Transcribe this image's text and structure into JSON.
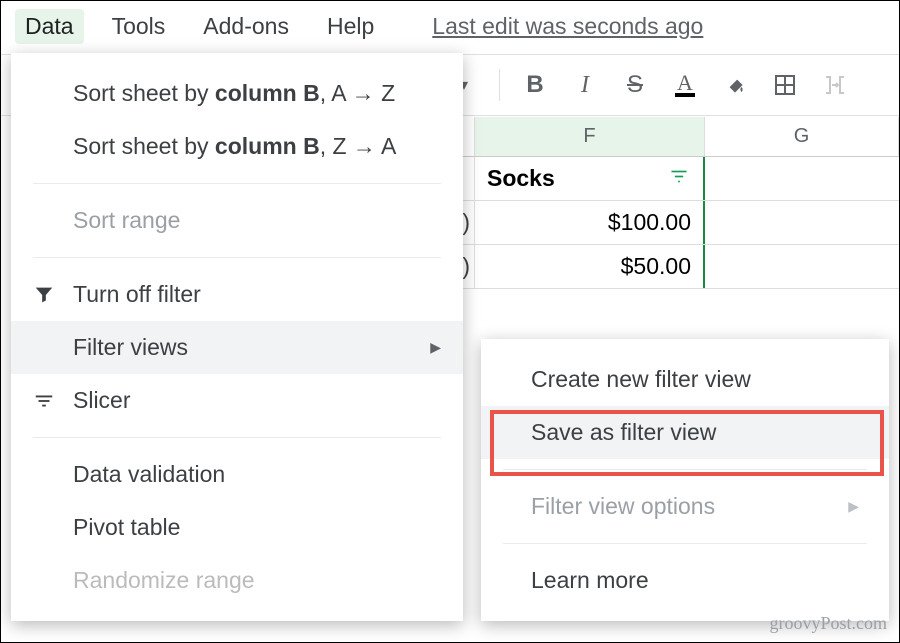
{
  "menubar": {
    "data": "Data",
    "tools": "Tools",
    "addons": "Add-ons",
    "help": "Help",
    "last_edit": "Last edit was seconds ago"
  },
  "toolbar": {
    "caret": "▾",
    "bold": "B",
    "italic": "I",
    "strike": "S",
    "textcolor": "A"
  },
  "sheet": {
    "col_F": "F",
    "col_G": "G",
    "header_F": "Socks",
    "row1_partial": ")",
    "row1_F": "$100.00",
    "row2_partial": ")",
    "row2_F": "$50.00"
  },
  "data_menu": {
    "sort_az_prefix": "Sort sheet by ",
    "sort_az_bold": "column B",
    "sort_az_suffix": ", A → Z",
    "sort_za_prefix": "Sort sheet by ",
    "sort_za_bold": "column B",
    "sort_za_suffix": ", Z → A",
    "sort_range": "Sort range",
    "turn_off_filter": "Turn off filter",
    "filter_views": "Filter views",
    "slicer": "Slicer",
    "data_validation": "Data validation",
    "pivot_table": "Pivot table",
    "randomize": "Randomize range"
  },
  "filter_submenu": {
    "create": "Create new filter view",
    "save_as": "Save as filter view",
    "options": "Filter view options",
    "learn_more": "Learn more"
  },
  "watermark": "groovyPost.com"
}
